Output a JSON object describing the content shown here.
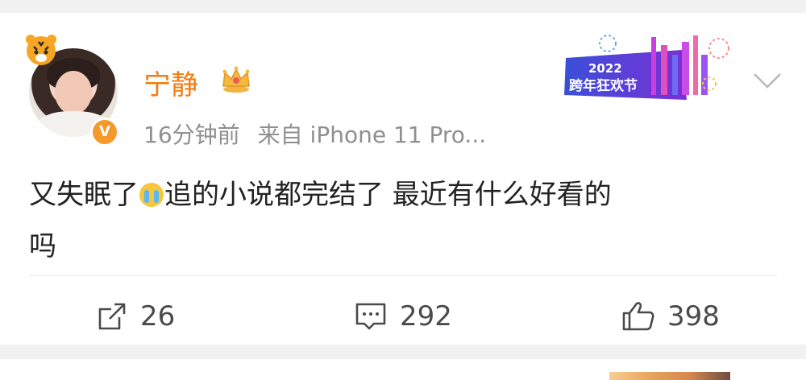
{
  "post": {
    "author_name": "宁静",
    "time": "16分钟前",
    "source": "来自 iPhone 11 Pro...",
    "verified_badge": "V",
    "content_line1_a": "又失眠了",
    "content_line1_b": "追的小说都完结了 最近有什么好看的",
    "content_line2": "吗",
    "banner_text": "2022",
    "banner_subtext": "跨年狂欢节",
    "icons": {
      "crown": "crown-icon",
      "more": "chevron-down-icon",
      "repost": "repost-icon",
      "comment": "comment-icon",
      "like": "like-icon",
      "emoji": "crying-emoji"
    },
    "colors": {
      "name": "#f47b12",
      "meta": "#8f8f8f",
      "badge": "#f59a2a",
      "text": "#222222"
    }
  },
  "actions": {
    "repost_count": "26",
    "comment_count": "292",
    "like_count": "398"
  }
}
